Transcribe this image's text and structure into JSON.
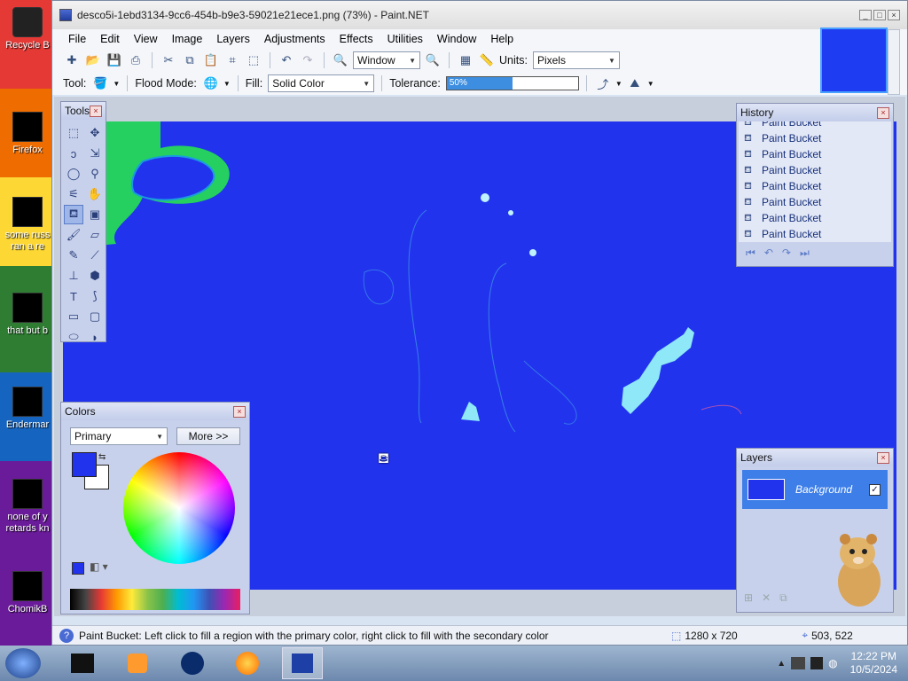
{
  "desktop": {
    "icons": [
      {
        "label": "Recycle B"
      },
      {
        "label": "Firefox"
      },
      {
        "label": "some russ ran a re"
      },
      {
        "label": "that but b"
      },
      {
        "label": "Endermar"
      },
      {
        "label": "none of y retards kn"
      },
      {
        "label": "ChomikB"
      }
    ]
  },
  "window": {
    "title": "desco5i-1ebd3134-9cc6-454b-b9e3-59021e21ece1.png (73%) - Paint.NET",
    "buttons": {
      "min": "_",
      "max": "□",
      "close": "×"
    }
  },
  "menu": [
    "File",
    "Edit",
    "View",
    "Image",
    "Layers",
    "Adjustments",
    "Effects",
    "Utilities",
    "Window",
    "Help"
  ],
  "toolbar1": {
    "zoom_value": "Window",
    "units_label": "Units:",
    "units_value": "Pixels"
  },
  "toolbar2": {
    "tool_label": "Tool:",
    "flood_label": "Flood Mode:",
    "fill_label": "Fill:",
    "fill_value": "Solid Color",
    "tolerance_label": "Tolerance:",
    "tolerance_value": "50%",
    "tolerance_fraction": 0.5
  },
  "tools_panel": {
    "title": "Tools",
    "tools": [
      "rect-select-icon",
      "move-select-icon",
      "lasso-icon",
      "move-selection-icon",
      "ellipse-select-icon",
      "zoom-icon",
      "magic-wand-icon",
      "pan-icon",
      "paint-bucket-icon",
      "gradient-icon",
      "paintbrush-icon",
      "eraser-icon",
      "pencil-icon",
      "color-picker-icon",
      "clone-stamp-icon",
      "recolor-icon",
      "text-icon",
      "line-icon",
      "rectangle-icon",
      "rounded-rect-icon",
      "ellipse-icon",
      "freeform-icon"
    ]
  },
  "colors_panel": {
    "title": "Colors",
    "mode": "Primary",
    "more_button": "More >>",
    "primary_color": "#2233ee",
    "secondary_color": "#ffffff"
  },
  "history_panel": {
    "title": "History",
    "items": [
      "Paint Bucket",
      "Paint Bucket",
      "Paint Bucket",
      "Paint Bucket",
      "Paint Bucket",
      "Paint Bucket",
      "Paint Bucket",
      "Paint Bucket",
      "Paint Bucket"
    ]
  },
  "layers_panel": {
    "title": "Layers",
    "layer_name": "Background"
  },
  "status": {
    "help_text": "Paint Bucket: Left click to fill a region with the primary color, right click to fill with the secondary color",
    "image_size": "1280 x 720",
    "cursor_pos": "503, 522"
  },
  "taskbar": {
    "time": "12:22 PM",
    "date": "10/5/2024"
  },
  "colors": {
    "canvas_blue": "#2233ee",
    "green_blob": "#25d060",
    "cyan_blob": "#8ee8f8"
  }
}
